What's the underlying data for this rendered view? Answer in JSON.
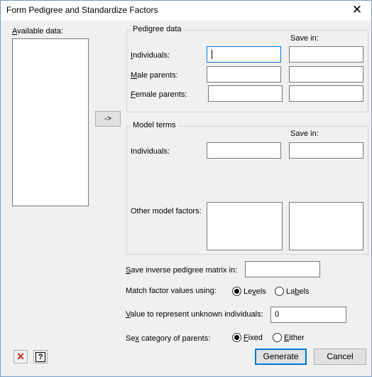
{
  "window": {
    "title": "Form Pedigree and Standardize Factors",
    "close_glyph": "✕"
  },
  "available_data": {
    "label_prefix": "",
    "label_key": "A",
    "label_rest": "vailable data:"
  },
  "transfer_button": {
    "label": "->"
  },
  "pedigree": {
    "group_title": "Pedigree data",
    "save_in_label": "Save in:",
    "individuals": {
      "key": "I",
      "rest": "ndividuals:"
    },
    "male_parents": {
      "key": "M",
      "rest": "ale parents:"
    },
    "female_parents": {
      "key": "F",
      "rest": "emale parents:"
    }
  },
  "model_terms": {
    "group_title": "Model terms",
    "save_in_label": "Save in:",
    "individuals_label": "Individuals:",
    "other_factors_label": "Other model factors:"
  },
  "save_inverse": {
    "key": "S",
    "rest": "ave inverse pedigree matrix in:"
  },
  "match_factor": {
    "label": "Match factor values using:",
    "levels": {
      "pre": "Le",
      "key": "v",
      "rest": "els",
      "selected": true
    },
    "labels": {
      "pre": "La",
      "key": "b",
      "rest": "els",
      "selected": false
    }
  },
  "unknown_value": {
    "key": "V",
    "rest": "alue to represent unknown individuals:",
    "value": "0"
  },
  "sex_category": {
    "key": "x",
    "pre": "Se",
    "rest": " category of parents:",
    "fixed": {
      "key": "F",
      "rest": "ixed",
      "selected": true
    },
    "either": {
      "key": "E",
      "rest": "ither",
      "selected": false
    }
  },
  "buttons": {
    "generate": "Generate",
    "cancel": "Cancel"
  },
  "toolbar": {
    "clear_glyph": "✕",
    "help_glyph": "?"
  },
  "colors": {
    "accent": "#0078d7",
    "clear_red": "#c42b1c"
  }
}
